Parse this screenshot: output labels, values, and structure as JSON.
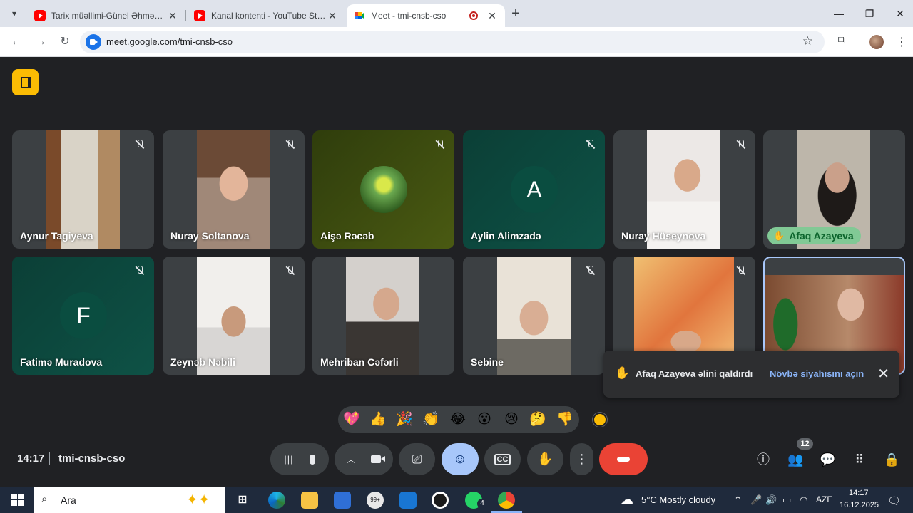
{
  "browser": {
    "tabs": [
      {
        "title": "Tarix müəllimi-Günel Əhmədova",
        "icon": "youtube-icon"
      },
      {
        "title": "Kanal kontenti - YouTube Studio",
        "icon": "youtube-studio-icon"
      },
      {
        "title": "Meet - tmi-cnsb-cso",
        "icon": "google-meet-icon",
        "active": true,
        "recording": true
      }
    ],
    "url": "meet.google.com/tmi-cnsb-cso"
  },
  "meet": {
    "participants": [
      {
        "name": "Aynur Tagiyeva",
        "type": "video",
        "muted": true
      },
      {
        "name": "Nuray Soltanova",
        "type": "video",
        "muted": true
      },
      {
        "name": "Aişə Rəcəb",
        "type": "photo",
        "muted": true
      },
      {
        "name": "Aylin Alimzadə",
        "type": "letter",
        "letter": "A",
        "muted": true
      },
      {
        "name": "Nuray Hüseynova",
        "type": "video",
        "muted": true
      },
      {
        "name": "Afaq Azayeva",
        "type": "video",
        "muted": false,
        "hand_raised": true
      },
      {
        "name": "Fatimə Muradova",
        "type": "letter",
        "letter": "F",
        "muted": true
      },
      {
        "name": "Zeynəb Nəbili",
        "type": "video",
        "muted": true
      },
      {
        "name": "Mehriban Cəfərli",
        "type": "video",
        "muted": false
      },
      {
        "name": "Sebine",
        "type": "video",
        "muted": true
      },
      {
        "name": "",
        "type": "video",
        "muted": true
      },
      {
        "name": "",
        "type": "self",
        "muted": false
      }
    ],
    "toast": {
      "message": "Afaq Azayeva əlini qaldırdı",
      "link": "Növbə siyahısını açın"
    },
    "reactions": [
      "💖",
      "👍",
      "🎉",
      "👏",
      "😂",
      "😮",
      "😢",
      "🤔",
      "👎"
    ],
    "time": "14:17",
    "meeting_code": "tmi-cnsb-cso",
    "participant_count": "12",
    "colors": {
      "accent_blue": "#a8c7fa",
      "end_call_red": "#ea4335",
      "hand_green": "#81c995",
      "badge_yellow": "#fbbc04"
    }
  },
  "taskbar": {
    "search_placeholder": "Ara",
    "weather": "5°C  Mostly cloudy",
    "language": "AZE",
    "time": "14:17",
    "date": "16.12.2025",
    "whatsapp_badge": "4",
    "mail_badge": "99+"
  }
}
